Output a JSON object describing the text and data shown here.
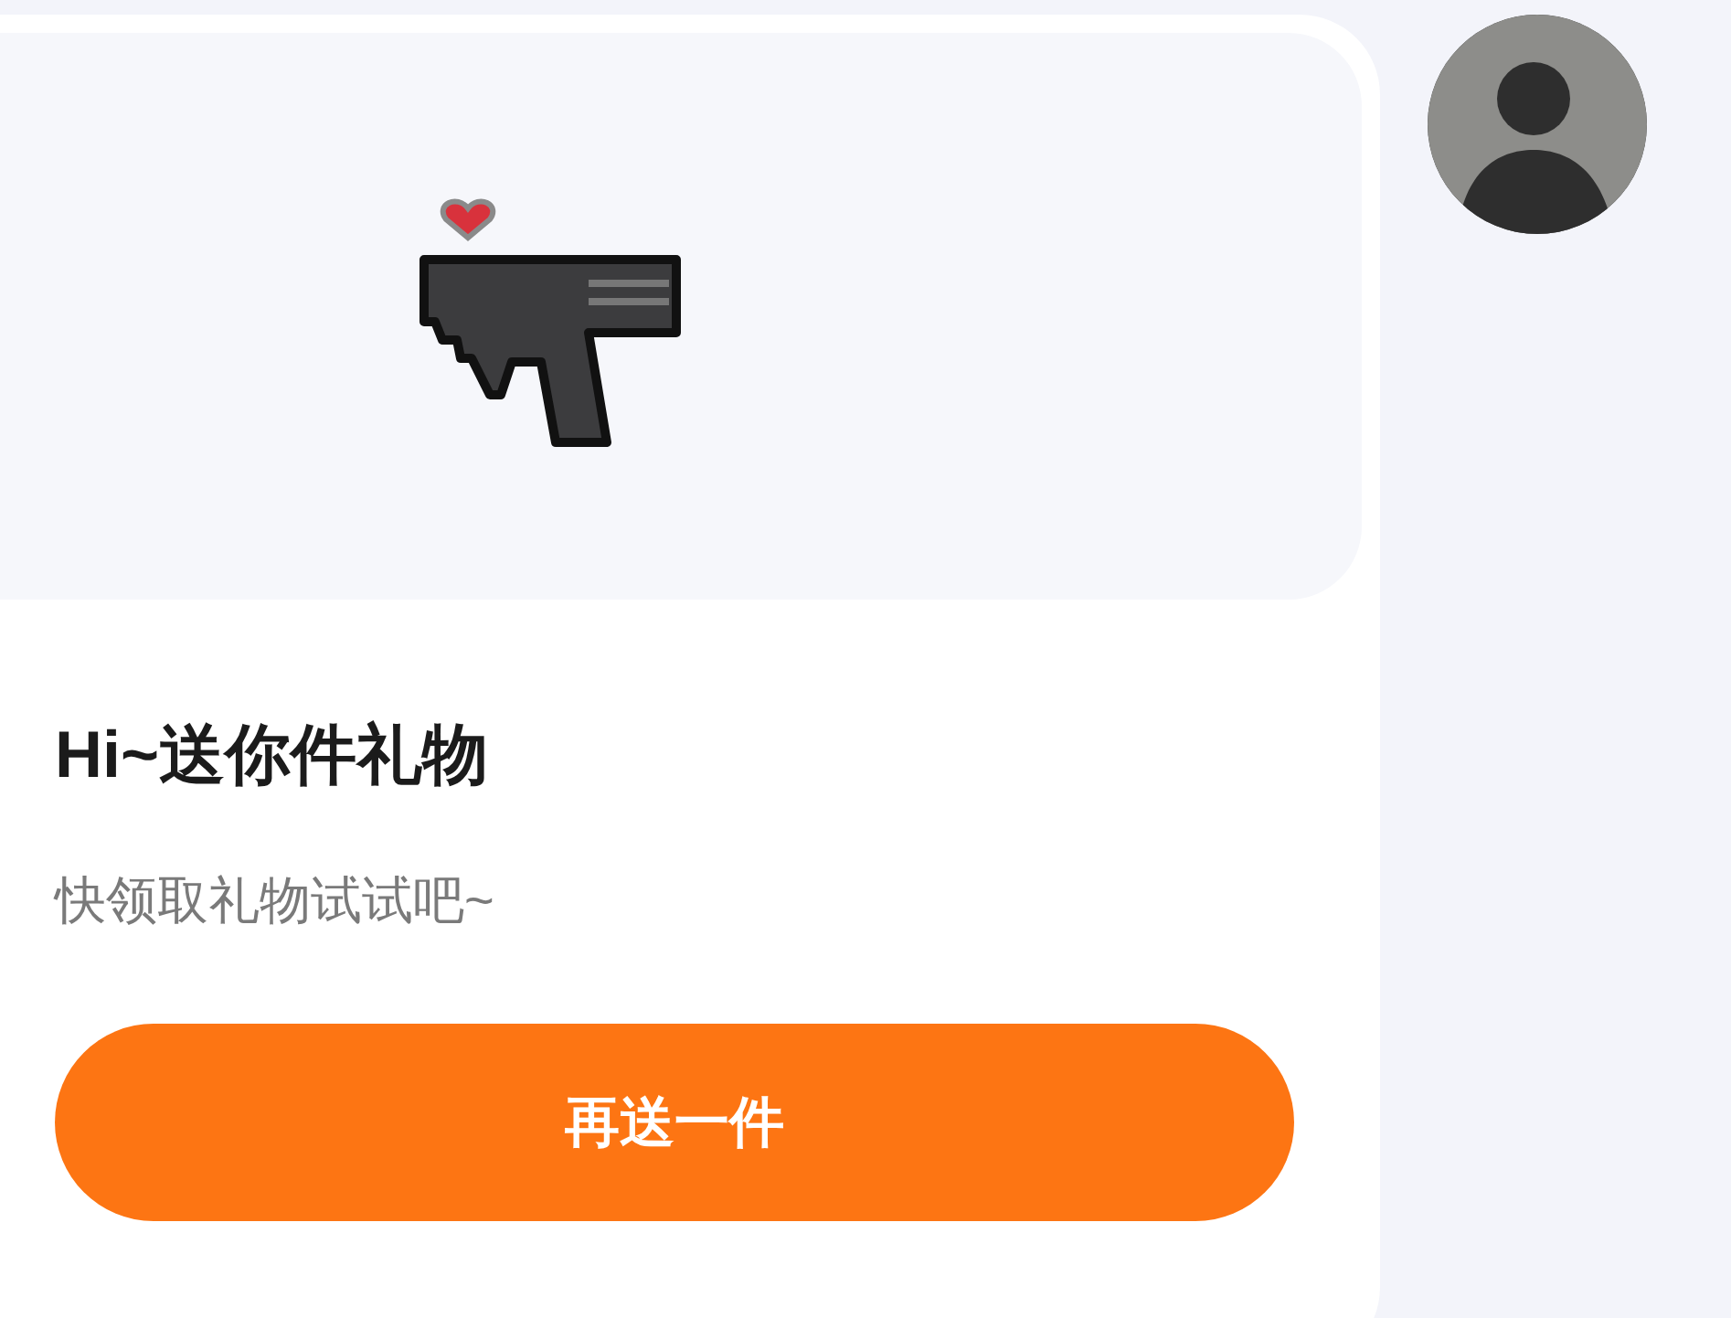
{
  "message": {
    "title": "Hi~送你件礼物",
    "subtitle": "快领取礼物试试吧~",
    "button": "再送一件"
  }
}
